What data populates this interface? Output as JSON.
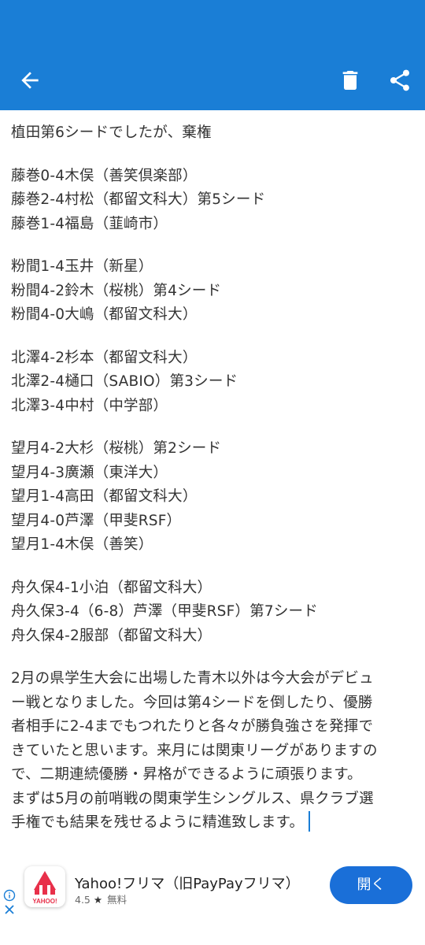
{
  "colors": {
    "appbar": "#1a7ed6",
    "ad_button": "#1a6fd8",
    "cursor": "#1a7ed6"
  },
  "toolbar": {
    "back_icon": "arrow-left-icon",
    "delete_icon": "trash-icon",
    "share_icon": "share-icon"
  },
  "post": {
    "lines": [
      "植田第6シードでしたが、棄権",
      "",
      "藤巻0-4木俣（善笑倶楽部）",
      "藤巻2-4村松（都留文科大）第5シード",
      "藤巻1-4福島（韮崎市）",
      "",
      "粉間1-4玉井（新星）",
      "粉間4-2鈴木（桜桃）第4シード",
      "粉間4-0大嶋（都留文科大）",
      "",
      "北澤4-2杉本（都留文科大）",
      "北澤2-4樋口（SABIO）第3シード",
      "北澤3-4中村（中学部）",
      "",
      "望月4-2大杉（桜桃）第2シード",
      "望月4-3廣瀬（東洋大）",
      "望月1-4高田（都留文科大）",
      "望月4-0芦澤（甲斐RSF）",
      "望月1-4木俣（善笑）",
      "",
      "舟久保4-1小泊（都留文科大）",
      "舟久保3-4（6-8）芦澤（甲斐RSF）第7シード",
      "舟久保4-2服部（都留文科大）",
      ""
    ],
    "paragraph": [
      "2月の県学生大会に出場した青木以外は今大会がデビュ",
      "ー戦となりました。今回は第4シードを倒したり、優勝",
      "者相手に2-4までもつれたりと各々が勝負強さを発揮で",
      "きていたと思います。来月には関東リーグがありますの",
      "で、二期連続優勝・昇格ができるように頑張ります。",
      "まずは5月の前哨戦の関東学生シングルス、県クラブ選",
      "手権でも結果を残せるように精進致します。"
    ]
  },
  "ad": {
    "title": "Yahoo!フリマ（旧PayPayフリマ）",
    "rating": "4.5",
    "rating_icon": "star-icon",
    "price": "無料",
    "button": "開く",
    "logo_text": "YAHOO!"
  }
}
